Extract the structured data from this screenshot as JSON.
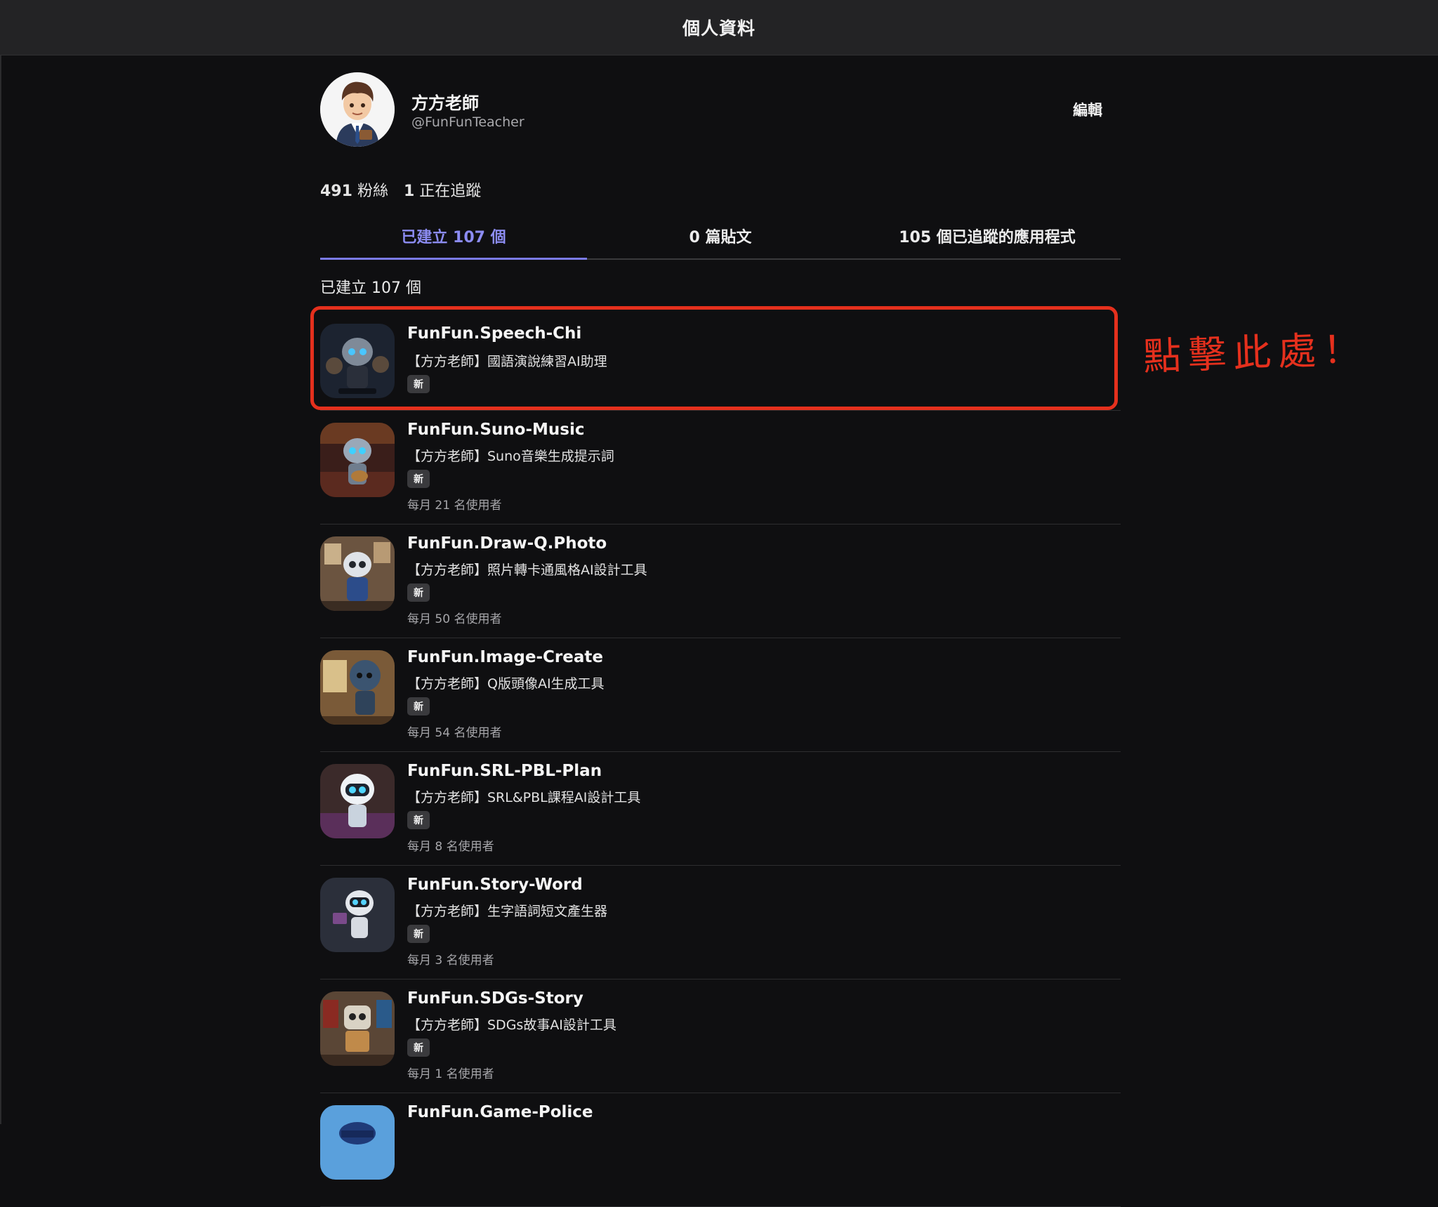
{
  "header": {
    "title": "個人資料"
  },
  "profile": {
    "name": "方方老師",
    "handle": "@FunFunTeacher",
    "edit_label": "編輯"
  },
  "stats": {
    "followers_count": "491",
    "followers_label": "粉絲",
    "following_count": "1",
    "following_label": "正在追蹤"
  },
  "tabs": [
    {
      "label": "已建立 107 個",
      "active": true
    },
    {
      "label": "0 篇貼文",
      "active": false
    },
    {
      "label": "105 個已追蹤的應用程式",
      "active": false
    }
  ],
  "section_heading": "已建立 107 個",
  "annotation": "點擊此處！",
  "apps": [
    {
      "title": "FunFun.Speech-Chi",
      "desc": "【方方老師】國語演說練習AI助理",
      "badge": "新",
      "users": ""
    },
    {
      "title": "FunFun.Suno-Music",
      "desc": "【方方老師】Suno音樂生成提示詞",
      "badge": "新",
      "users": "每月 21 名使用者"
    },
    {
      "title": "FunFun.Draw-Q.Photo",
      "desc": "【方方老師】照片轉卡通風格AI設計工具",
      "badge": "新",
      "users": "每月 50 名使用者"
    },
    {
      "title": "FunFun.Image-Create",
      "desc": "【方方老師】Q版頭像AI生成工具",
      "badge": "新",
      "users": "每月 54 名使用者"
    },
    {
      "title": "FunFun.SRL-PBL-Plan",
      "desc": "【方方老師】SRL&PBL課程AI設計工具",
      "badge": "新",
      "users": "每月 8 名使用者"
    },
    {
      "title": "FunFun.Story-Word",
      "desc": "【方方老師】生字語詞短文產生器",
      "badge": "新",
      "users": "每月 3 名使用者"
    },
    {
      "title": "FunFun.SDGs-Story",
      "desc": "【方方老師】SDGs故事AI設計工具",
      "badge": "新",
      "users": "每月 1 名使用者"
    },
    {
      "title": "FunFun.Game-Police",
      "desc": "",
      "badge": "",
      "users": ""
    }
  ],
  "colors": {
    "background": "#0f0f11",
    "header_bg": "#232325",
    "accent": "#8c8cf2",
    "annotation_red": "#e5301d"
  }
}
